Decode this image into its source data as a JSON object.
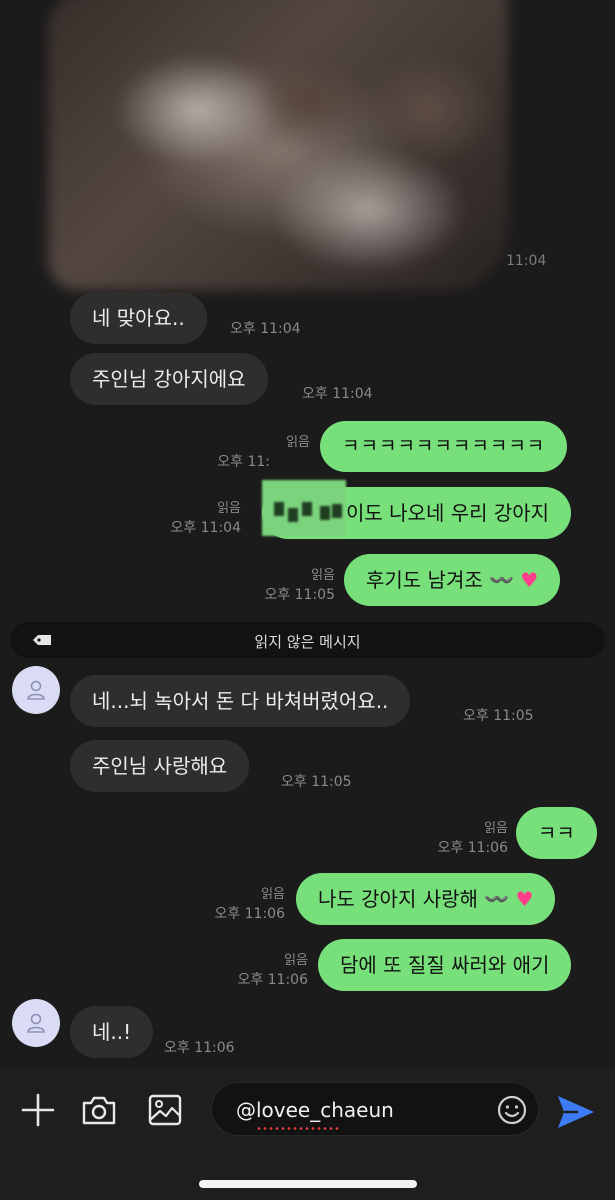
{
  "photo": {
    "time": "11:04"
  },
  "messages": [
    {
      "text": "네 맞아요..",
      "time": "오후 11:04"
    },
    {
      "text": "주인님 강아지에요",
      "time": "오후 11:04"
    },
    {
      "text": "ㅋㅋㅋㅋㅋㅋㅋㅋㅋㅋㅋ",
      "read": "읽음",
      "time": "오후 11:"
    },
    {
      "text": "이도 나오네 우리 강아지",
      "read": "읽음",
      "time": "오후 11:04"
    },
    {
      "text": "후기도 남겨조 〰️",
      "emoji": "♥",
      "read": "읽음",
      "time": "오후 11:05"
    },
    {
      "text": "네...뇌 녹아서 돈 다 바쳐버렸어요..",
      "time": "오후 11:05"
    },
    {
      "text": "주인님 사랑해요",
      "time": "오후 11:05"
    },
    {
      "text": "ㅋㅋ",
      "read": "읽음",
      "time": "오후 11:06"
    },
    {
      "text": "나도 강아지 사랑해 〰️",
      "emoji": "♥",
      "read": "읽음",
      "time": "오후 11:06"
    },
    {
      "text": "담에 또 질질 싸러와 애기",
      "read": "읽음",
      "time": "오후 11:06"
    },
    {
      "text": "네..!",
      "time": "오후 11:06"
    }
  ],
  "divider": {
    "label": "읽지 않은 메시지",
    "icon": "tag-icon"
  },
  "composer": {
    "value": "@lovee_chaeun",
    "icons": [
      "plus-icon",
      "camera-icon",
      "image-icon",
      "emoji-icon",
      "send-icon"
    ]
  },
  "colors": {
    "outgoing": "#78e07a",
    "incoming": "#2e2e2e",
    "send": "#3d7bf5",
    "avatar": "#d9dcf4"
  }
}
